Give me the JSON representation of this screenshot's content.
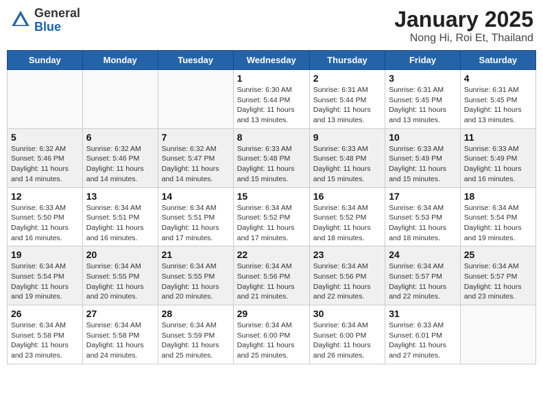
{
  "header": {
    "logo_general": "General",
    "logo_blue": "Blue",
    "title": "January 2025",
    "location": "Nong Hi, Roi Et, Thailand"
  },
  "days_of_week": [
    "Sunday",
    "Monday",
    "Tuesday",
    "Wednesday",
    "Thursday",
    "Friday",
    "Saturday"
  ],
  "weeks": [
    [
      {
        "day": "",
        "info": ""
      },
      {
        "day": "",
        "info": ""
      },
      {
        "day": "",
        "info": ""
      },
      {
        "day": "1",
        "info": "Sunrise: 6:30 AM\nSunset: 5:44 PM\nDaylight: 11 hours\nand 13 minutes."
      },
      {
        "day": "2",
        "info": "Sunrise: 6:31 AM\nSunset: 5:44 PM\nDaylight: 11 hours\nand 13 minutes."
      },
      {
        "day": "3",
        "info": "Sunrise: 6:31 AM\nSunset: 5:45 PM\nDaylight: 11 hours\nand 13 minutes."
      },
      {
        "day": "4",
        "info": "Sunrise: 6:31 AM\nSunset: 5:45 PM\nDaylight: 11 hours\nand 13 minutes."
      }
    ],
    [
      {
        "day": "5",
        "info": "Sunrise: 6:32 AM\nSunset: 5:46 PM\nDaylight: 11 hours\nand 14 minutes."
      },
      {
        "day": "6",
        "info": "Sunrise: 6:32 AM\nSunset: 5:46 PM\nDaylight: 11 hours\nand 14 minutes."
      },
      {
        "day": "7",
        "info": "Sunrise: 6:32 AM\nSunset: 5:47 PM\nDaylight: 11 hours\nand 14 minutes."
      },
      {
        "day": "8",
        "info": "Sunrise: 6:33 AM\nSunset: 5:48 PM\nDaylight: 11 hours\nand 15 minutes."
      },
      {
        "day": "9",
        "info": "Sunrise: 6:33 AM\nSunset: 5:48 PM\nDaylight: 11 hours\nand 15 minutes."
      },
      {
        "day": "10",
        "info": "Sunrise: 6:33 AM\nSunset: 5:49 PM\nDaylight: 11 hours\nand 15 minutes."
      },
      {
        "day": "11",
        "info": "Sunrise: 6:33 AM\nSunset: 5:49 PM\nDaylight: 11 hours\nand 16 minutes."
      }
    ],
    [
      {
        "day": "12",
        "info": "Sunrise: 6:33 AM\nSunset: 5:50 PM\nDaylight: 11 hours\nand 16 minutes."
      },
      {
        "day": "13",
        "info": "Sunrise: 6:34 AM\nSunset: 5:51 PM\nDaylight: 11 hours\nand 16 minutes."
      },
      {
        "day": "14",
        "info": "Sunrise: 6:34 AM\nSunset: 5:51 PM\nDaylight: 11 hours\nand 17 minutes."
      },
      {
        "day": "15",
        "info": "Sunrise: 6:34 AM\nSunset: 5:52 PM\nDaylight: 11 hours\nand 17 minutes."
      },
      {
        "day": "16",
        "info": "Sunrise: 6:34 AM\nSunset: 5:52 PM\nDaylight: 11 hours\nand 18 minutes."
      },
      {
        "day": "17",
        "info": "Sunrise: 6:34 AM\nSunset: 5:53 PM\nDaylight: 11 hours\nand 18 minutes."
      },
      {
        "day": "18",
        "info": "Sunrise: 6:34 AM\nSunset: 5:54 PM\nDaylight: 11 hours\nand 19 minutes."
      }
    ],
    [
      {
        "day": "19",
        "info": "Sunrise: 6:34 AM\nSunset: 5:54 PM\nDaylight: 11 hours\nand 19 minutes."
      },
      {
        "day": "20",
        "info": "Sunrise: 6:34 AM\nSunset: 5:55 PM\nDaylight: 11 hours\nand 20 minutes."
      },
      {
        "day": "21",
        "info": "Sunrise: 6:34 AM\nSunset: 5:55 PM\nDaylight: 11 hours\nand 20 minutes."
      },
      {
        "day": "22",
        "info": "Sunrise: 6:34 AM\nSunset: 5:56 PM\nDaylight: 11 hours\nand 21 minutes."
      },
      {
        "day": "23",
        "info": "Sunrise: 6:34 AM\nSunset: 5:56 PM\nDaylight: 11 hours\nand 22 minutes."
      },
      {
        "day": "24",
        "info": "Sunrise: 6:34 AM\nSunset: 5:57 PM\nDaylight: 11 hours\nand 22 minutes."
      },
      {
        "day": "25",
        "info": "Sunrise: 6:34 AM\nSunset: 5:57 PM\nDaylight: 11 hours\nand 23 minutes."
      }
    ],
    [
      {
        "day": "26",
        "info": "Sunrise: 6:34 AM\nSunset: 5:58 PM\nDaylight: 11 hours\nand 23 minutes."
      },
      {
        "day": "27",
        "info": "Sunrise: 6:34 AM\nSunset: 5:58 PM\nDaylight: 11 hours\nand 24 minutes."
      },
      {
        "day": "28",
        "info": "Sunrise: 6:34 AM\nSunset: 5:59 PM\nDaylight: 11 hours\nand 25 minutes."
      },
      {
        "day": "29",
        "info": "Sunrise: 6:34 AM\nSunset: 6:00 PM\nDaylight: 11 hours\nand 25 minutes."
      },
      {
        "day": "30",
        "info": "Sunrise: 6:34 AM\nSunset: 6:00 PM\nDaylight: 11 hours\nand 26 minutes."
      },
      {
        "day": "31",
        "info": "Sunrise: 6:33 AM\nSunset: 6:01 PM\nDaylight: 11 hours\nand 27 minutes."
      },
      {
        "day": "",
        "info": ""
      }
    ]
  ]
}
